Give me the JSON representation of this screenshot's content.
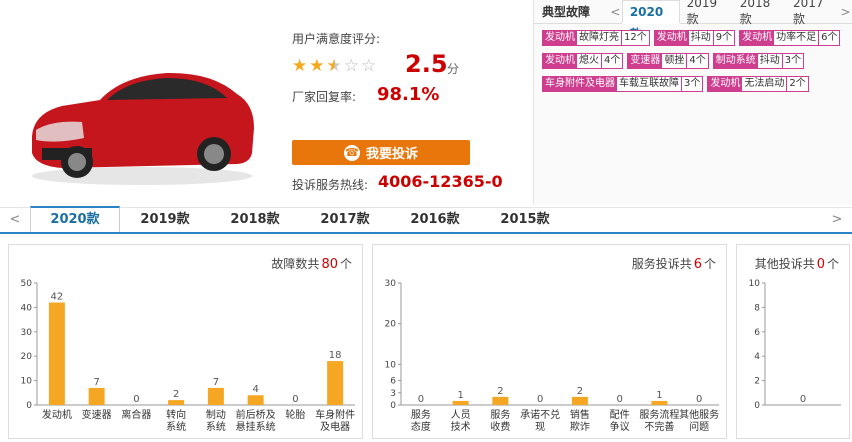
{
  "rating": {
    "label": "用户满意度评分:",
    "score": "2.5",
    "unit": "分",
    "stars": 2.5,
    "max_stars": 5,
    "reply_label": "厂家回复率:",
    "reply_value": "98.1%"
  },
  "complain_button": "我要投诉",
  "hotline": {
    "label": "投诉服务热线:",
    "number": "4006-12365-0"
  },
  "faults": {
    "title": "典型故障",
    "tabs": [
      "2020款",
      "2019款",
      "2018款",
      "2017款"
    ],
    "active_tab": "2020款",
    "tags": [
      {
        "part": "发动机",
        "name": "故障灯亮",
        "count": "12个"
      },
      {
        "part": "发动机",
        "name": "抖动",
        "count": "9个"
      },
      {
        "part": "发动机",
        "name": "功率不足",
        "count": "6个"
      },
      {
        "part": "发动机",
        "name": "熄火",
        "count": "4个"
      },
      {
        "part": "变速器",
        "name": "顿挫",
        "count": "4个"
      },
      {
        "part": "制动系统",
        "name": "抖动",
        "count": "3个"
      },
      {
        "part": "车身附件及电器",
        "name": "车载互联故障",
        "count": "3个"
      },
      {
        "part": "发动机",
        "name": "无法启动",
        "count": "2个"
      }
    ]
  },
  "year_tabs": [
    "2020款",
    "2019款",
    "2018款",
    "2017款",
    "2016款",
    "2015款"
  ],
  "active_year": "2020款",
  "panels": [
    {
      "title_prefix": "故障数共",
      "total": "80",
      "title_suffix": "个"
    },
    {
      "title_prefix": "服务投诉共",
      "total": "6",
      "title_suffix": "个"
    },
    {
      "title_prefix": "其他投诉共",
      "total": "0",
      "title_suffix": "个"
    }
  ],
  "colors": {
    "bar": "#f5a623",
    "accent": "#c00000",
    "button": "#e8760a",
    "tag": "#cf3d8f",
    "tab_line": "#2b82c7"
  },
  "chart_data": [
    {
      "type": "bar",
      "ylim": [
        0,
        50
      ],
      "yticks": [
        0,
        10,
        20,
        30,
        40,
        50
      ],
      "categories": [
        "发动机",
        "变速器",
        "离合器",
        "转向\n系统",
        "制动\n系统",
        "前后桥及\n悬挂系统",
        "轮胎",
        "车身附件\n及电器"
      ],
      "values": [
        42,
        7,
        0,
        2,
        7,
        4,
        0,
        18
      ]
    },
    {
      "type": "bar",
      "ylim": [
        0,
        30
      ],
      "yticks": [
        0,
        3,
        6,
        10,
        20,
        30
      ],
      "categories": [
        "服务\n态度",
        "人员\n技术",
        "服务\n收费",
        "承诺不兑\n现",
        "销售\n欺诈",
        "配件\n争议",
        "服务流程\n不完善",
        "其他服务\n问题"
      ],
      "values": [
        0,
        1,
        2,
        0,
        2,
        0,
        1,
        0
      ]
    },
    {
      "type": "bar",
      "ylim": [
        0,
        10
      ],
      "yticks": [
        0,
        2,
        4,
        6,
        8,
        10
      ],
      "categories": [
        ""
      ],
      "values": [
        0
      ]
    }
  ]
}
